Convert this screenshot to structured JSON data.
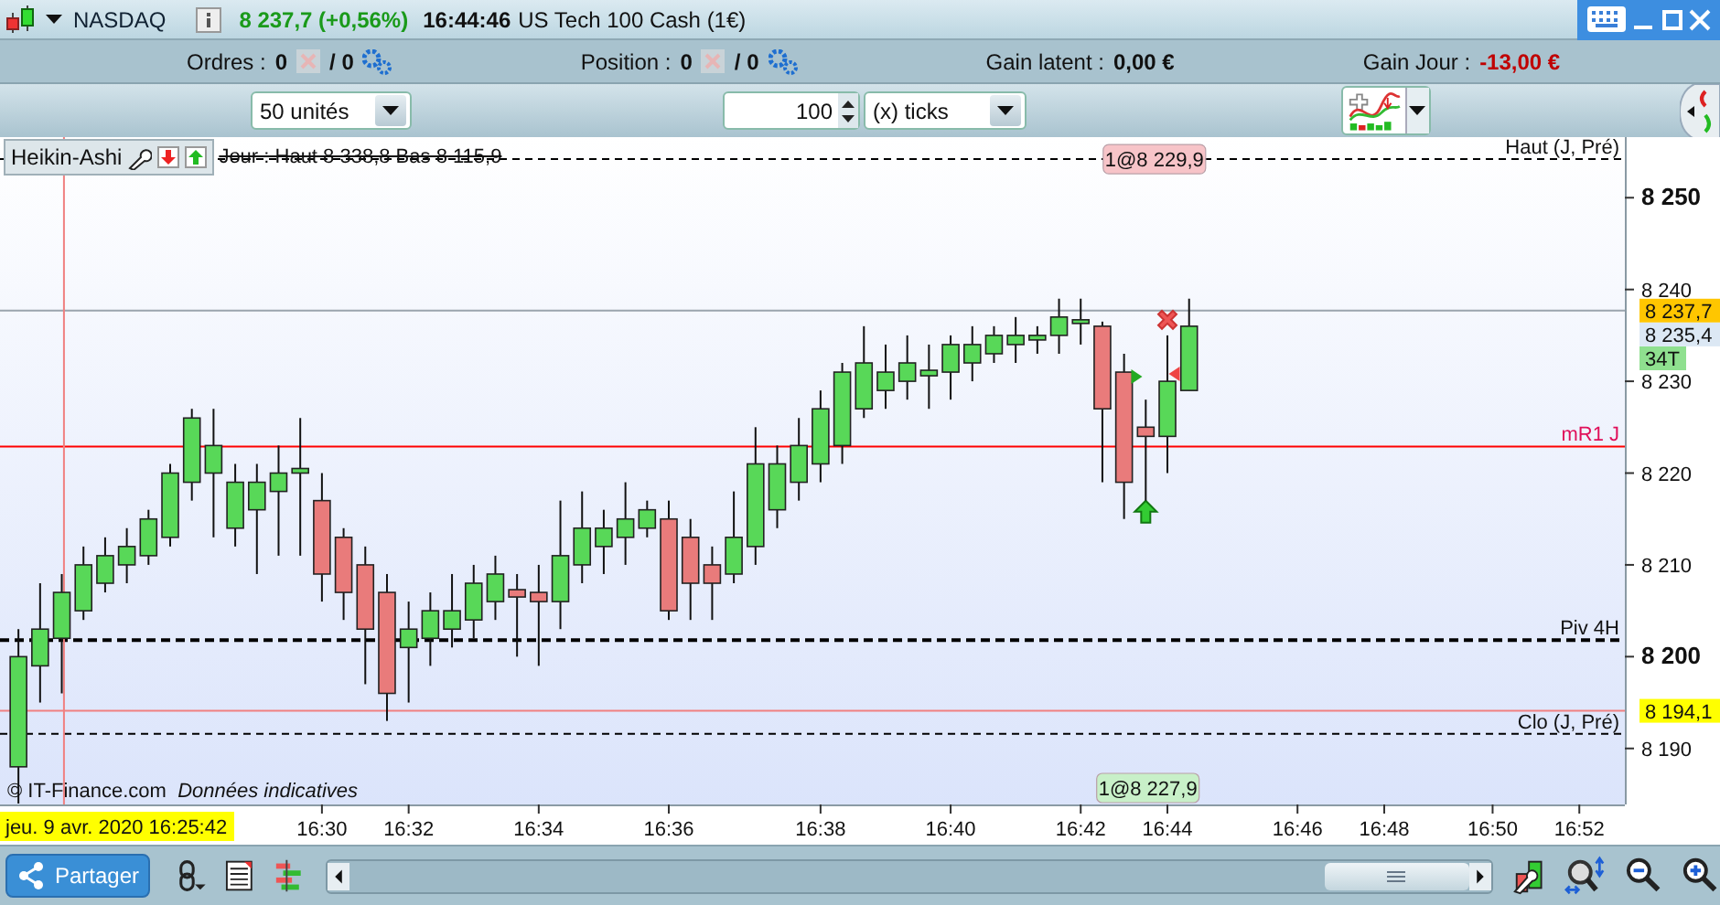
{
  "header": {
    "instrument": "NASDAQ",
    "quote": "8 237,7 (+0,56%)",
    "time": "16:44:46",
    "name": "US Tech 100 Cash (1€)"
  },
  "summary": [
    {
      "label": "Ordres :",
      "count": "0",
      "slash": "/ 0",
      "kind": "orders"
    },
    {
      "label": "Position :",
      "count": "0",
      "slash": "/ 0",
      "kind": "orders"
    },
    {
      "label": "Gain latent :",
      "value": "0,00 €",
      "kind": "gain",
      "negative": false
    },
    {
      "label": "Gain Jour :",
      "value": "-13,00 €",
      "kind": "gain",
      "negative": true
    }
  ],
  "toolbar": {
    "units": "50 unités",
    "quantity": "100",
    "mode": "(x) ticks"
  },
  "legend": {
    "style": "Heikin-Ashi",
    "day_range": "Jour : Haut 8 338,8 Bas 8 115,9"
  },
  "orders": [
    {
      "label": "1@8 229,9",
      "color": "#f7c4c8"
    },
    {
      "label": "1@8 227,9",
      "color": "#c8f0c8"
    }
  ],
  "chart_data": {
    "type": "candlestick",
    "ylim": [
      8183.9,
      8256.6
    ],
    "yticks": [
      {
        "value": 8250,
        "label": "8 250"
      },
      {
        "value": 8240,
        "label": "8 240"
      },
      {
        "value": 8230,
        "label": "8 230"
      },
      {
        "value": 8220,
        "label": "8 220"
      },
      {
        "value": 8210,
        "label": "8 210"
      },
      {
        "value": 8200,
        "label": "8 200"
      },
      {
        "value": 8190,
        "label": "8 190"
      }
    ],
    "categories": [
      null,
      null,
      null,
      null,
      null,
      null,
      null,
      null,
      null,
      null,
      null,
      null,
      null,
      null,
      "16:30",
      null,
      null,
      null,
      "16:32",
      null,
      null,
      null,
      null,
      null,
      "16:34",
      null,
      null,
      null,
      null,
      null,
      "16:36",
      null,
      null,
      null,
      null,
      null,
      null,
      "16:38",
      null,
      null,
      null,
      null,
      null,
      "16:40",
      null,
      null,
      null,
      null,
      null,
      "16:42",
      null,
      null,
      null,
      "16:44",
      null,
      null,
      null,
      null,
      null,
      "16:46",
      null,
      null,
      null,
      "16:48",
      null,
      null,
      null,
      null,
      "16:50",
      null,
      null,
      null,
      "16:52"
    ],
    "ohlc": [
      [
        8188,
        8203,
        8184,
        8200
      ],
      [
        8199,
        8208,
        8195,
        8203
      ],
      [
        8202,
        8209,
        8196,
        8207
      ],
      [
        8205,
        8212,
        8204,
        8210
      ],
      [
        8208,
        8213,
        8207,
        8211
      ],
      [
        8210,
        8214,
        8208,
        8212
      ],
      [
        8211,
        8216,
        8210,
        8215
      ],
      [
        8213,
        8221,
        8212,
        8220
      ],
      [
        8219,
        8227,
        8217,
        8226
      ],
      [
        8220,
        8227,
        8213,
        8223
      ],
      [
        8214,
        8221,
        8212,
        8219
      ],
      [
        8216,
        8221,
        8209,
        8219
      ],
      [
        8218,
        8223,
        8211,
        8220
      ],
      [
        8220,
        8226,
        8211,
        8220.5
      ],
      [
        8217,
        8220,
        8206,
        8209
      ],
      [
        8213,
        8214,
        8204,
        8207
      ],
      [
        8210,
        8212,
        8197,
        8203
      ],
      [
        8207,
        8209,
        8193,
        8196
      ],
      [
        8201,
        8206,
        8195,
        8203
      ],
      [
        8202,
        8207,
        8199,
        8205
      ],
      [
        8203,
        8209,
        8201,
        8205
      ],
      [
        8204,
        8210,
        8202,
        8208
      ],
      [
        8206,
        8211,
        8204,
        8209
      ],
      [
        8207.3,
        8209,
        8200,
        8206.5
      ],
      [
        8207,
        8210,
        8199,
        8206
      ],
      [
        8206,
        8217,
        8203,
        8211
      ],
      [
        8210,
        8218,
        8208,
        8214
      ],
      [
        8212,
        8216,
        8209,
        8214
      ],
      [
        8213,
        8219,
        8210,
        8215
      ],
      [
        8214,
        8217,
        8213,
        8216
      ],
      [
        8215,
        8217,
        8204,
        8205
      ],
      [
        8213,
        8215,
        8204,
        8208
      ],
      [
        8210,
        8212,
        8204,
        8208
      ],
      [
        8209,
        8218,
        8208,
        8213
      ],
      [
        8212,
        8225,
        8210,
        8221
      ],
      [
        8216,
        8223,
        8214,
        8221
      ],
      [
        8219,
        8226,
        8217,
        8223
      ],
      [
        8221,
        8229,
        8219,
        8227
      ],
      [
        8223,
        8232,
        8221,
        8231
      ],
      [
        8227,
        8236,
        8226,
        8232
      ],
      [
        8229,
        8234,
        8227,
        8231
      ],
      [
        8230,
        8235,
        8228,
        8232
      ],
      [
        8230.6,
        8234,
        8227,
        8231.2
      ],
      [
        8231,
        8235,
        8228,
        8234
      ],
      [
        8232,
        8236,
        8230,
        8234
      ],
      [
        8233,
        8236,
        8232,
        8235
      ],
      [
        8234,
        8237,
        8232,
        8235
      ],
      [
        8234.5,
        8236,
        8233,
        8235
      ],
      [
        8235,
        8239,
        8233,
        8237
      ],
      [
        8236.3,
        8239,
        8234,
        8236.7
      ],
      [
        8236,
        8236.5,
        8219,
        8227
      ],
      [
        8231,
        8233,
        8215,
        8219
      ],
      [
        8225,
        8228,
        8217,
        8224
      ],
      [
        8224,
        8235,
        8220,
        8230
      ],
      [
        8229,
        8239,
        8229,
        8236
      ],
      null,
      null,
      null,
      null,
      null,
      null,
      null,
      null,
      null,
      null,
      null,
      null,
      null,
      null,
      null,
      null,
      null,
      null
    ],
    "ref_lines": [
      {
        "axis": "y",
        "value": 8254.2,
        "label": "Haut (J, Pré)"
      },
      {
        "axis": "y",
        "value": 8237.7
      },
      {
        "axis": "y",
        "value": 8222.9,
        "label": "mR1 J"
      },
      {
        "axis": "y",
        "value": 8201.8,
        "label": "Piv 4H"
      },
      {
        "axis": "y",
        "value": 8194.1
      },
      {
        "axis": "y",
        "value": 8191.6,
        "label": "Clo (J, Pré)"
      }
    ]
  },
  "price_badges": [
    {
      "label": "8 237,7",
      "color": "#ffc600"
    },
    {
      "label": "8 235,4",
      "color": "#dce8f4"
    },
    {
      "label": "34T",
      "color": "#8fe08f"
    },
    {
      "label": "8 194,1",
      "color": "#ffff00"
    }
  ],
  "cursor_time": "jeu. 9 avr. 2020 16:25:42",
  "credit": {
    "source": "© IT-Finance.com",
    "note": "Données indicatives"
  },
  "share": {
    "label": "Partager"
  }
}
